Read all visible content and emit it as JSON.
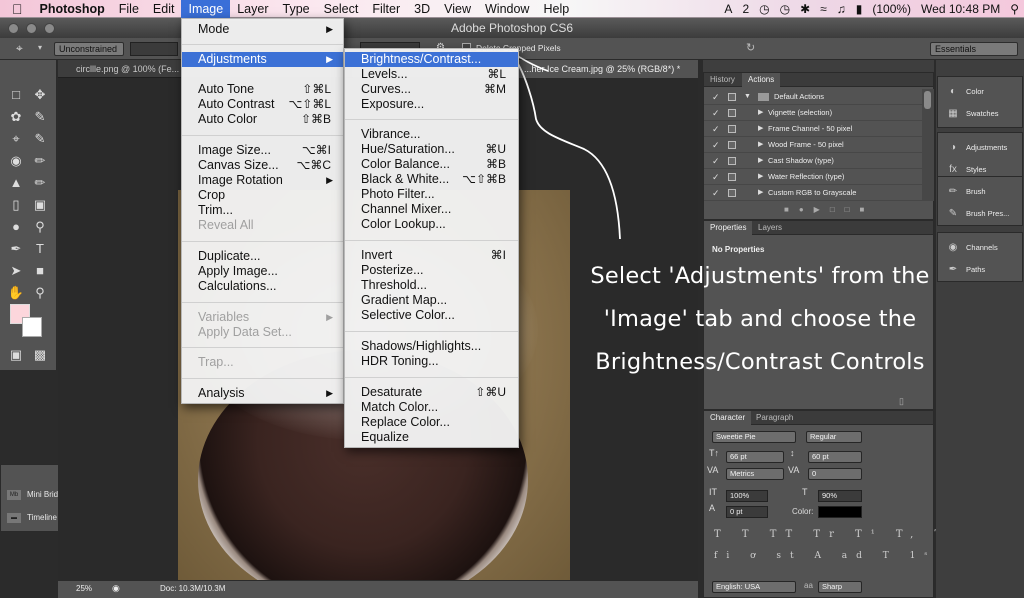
{
  "menubar": {
    "apple_icon": "apple-logo-icon",
    "app_name": "Photoshop",
    "items": [
      "File",
      "Edit",
      "Image",
      "Layer",
      "Type",
      "Select",
      "Filter",
      "3D",
      "View",
      "Window",
      "Help"
    ],
    "battery": "(100%)",
    "clock": "Wed 10:48 PM",
    "status_digit": "2"
  },
  "window": {
    "title": "Adobe Photoshop CS6"
  },
  "options": {
    "ratio": "Unconstrained",
    "delete_cropped": "Delete Cropped Pixels",
    "workspace": "Essentials"
  },
  "doc": {
    "tab1": "circllle.png @ 100% (Fe...",
    "tab2": "...her Ice Cream.jpg @ 25% (RGB/8*) *",
    "zoom": "25%",
    "doc_size": "Doc: 10.3M/10.3M"
  },
  "image_menu": {
    "items": [
      {
        "label": "Mode",
        "submenu": true
      },
      {
        "label": "Adjustments",
        "submenu": true,
        "highlighted": true
      },
      {
        "label": "Auto Tone",
        "shortcut": "⇧⌘L"
      },
      {
        "label": "Auto Contrast",
        "shortcut": "⌥⇧⌘L"
      },
      {
        "label": "Auto Color",
        "shortcut": "⇧⌘B"
      },
      {
        "label": "Image Size...",
        "shortcut": "⌥⌘I"
      },
      {
        "label": "Canvas Size...",
        "shortcut": "⌥⌘C"
      },
      {
        "label": "Image Rotation",
        "submenu": true
      },
      {
        "label": "Crop"
      },
      {
        "label": "Trim..."
      },
      {
        "label": "Reveal All",
        "disabled": true
      },
      {
        "label": "Duplicate..."
      },
      {
        "label": "Apply Image..."
      },
      {
        "label": "Calculations..."
      },
      {
        "label": "Variables",
        "submenu": true,
        "disabled": true
      },
      {
        "label": "Apply Data Set...",
        "disabled": true
      },
      {
        "label": "Trap...",
        "disabled": true
      },
      {
        "label": "Analysis",
        "submenu": true
      }
    ]
  },
  "adjustments_menu": {
    "items": [
      {
        "label": "Brightness/Contrast...",
        "highlighted": true
      },
      {
        "label": "Levels...",
        "shortcut": "⌘L"
      },
      {
        "label": "Curves...",
        "shortcut": "⌘M"
      },
      {
        "label": "Exposure..."
      },
      {
        "label": "Vibrance..."
      },
      {
        "label": "Hue/Saturation...",
        "shortcut": "⌘U"
      },
      {
        "label": "Color Balance...",
        "shortcut": "⌘B"
      },
      {
        "label": "Black & White...",
        "shortcut": "⌥⇧⌘B"
      },
      {
        "label": "Photo Filter..."
      },
      {
        "label": "Channel Mixer..."
      },
      {
        "label": "Color Lookup..."
      },
      {
        "label": "Invert",
        "shortcut": "⌘I"
      },
      {
        "label": "Posterize..."
      },
      {
        "label": "Threshold..."
      },
      {
        "label": "Gradient Map..."
      },
      {
        "label": "Selective Color..."
      },
      {
        "label": "Shadows/Highlights..."
      },
      {
        "label": "HDR Toning..."
      },
      {
        "label": "Desaturate",
        "shortcut": "⇧⌘U"
      },
      {
        "label": "Match Color..."
      },
      {
        "label": "Replace Color..."
      },
      {
        "label": "Equalize"
      }
    ]
  },
  "actions_panel": {
    "tabs": [
      "History",
      "Actions"
    ],
    "rows": [
      "Default Actions",
      "Vignette (selection)",
      "Frame Channel - 50 pixel",
      "Wood Frame - 50 pixel",
      "Cast Shadow (type)",
      "Water Reflection (type)",
      "Custom RGB to Grayscale"
    ]
  },
  "properties_panel": {
    "tabs": [
      "Properties",
      "Layers"
    ],
    "empty": "No Properties"
  },
  "character_panel": {
    "tabs": [
      "Character",
      "Paragraph"
    ],
    "font": "Sweetie Pie",
    "style": "Regular",
    "size": "66 pt",
    "leading": "60 pt",
    "kerning": "Metrics",
    "tracking": "0",
    "vscale": "100%",
    "hscale": "90%",
    "baseline": "0 pt",
    "color_label": "Color:",
    "language": "English: USA",
    "aa_label": "aa",
    "antialias": "Sharp"
  },
  "dock": {
    "items": [
      "Color",
      "Swatches",
      "Adjustments",
      "Styles",
      "Brush",
      "Brush Pres...",
      "Channels",
      "Paths"
    ]
  },
  "mini_panel": {
    "items": [
      "Mini Bridge",
      "Timeline"
    ]
  },
  "annotation": {
    "line1": "Select 'Adjustments' from the",
    "line2": "'Image' tab and choose the",
    "line3": "Brightness/Contrast Controls"
  }
}
